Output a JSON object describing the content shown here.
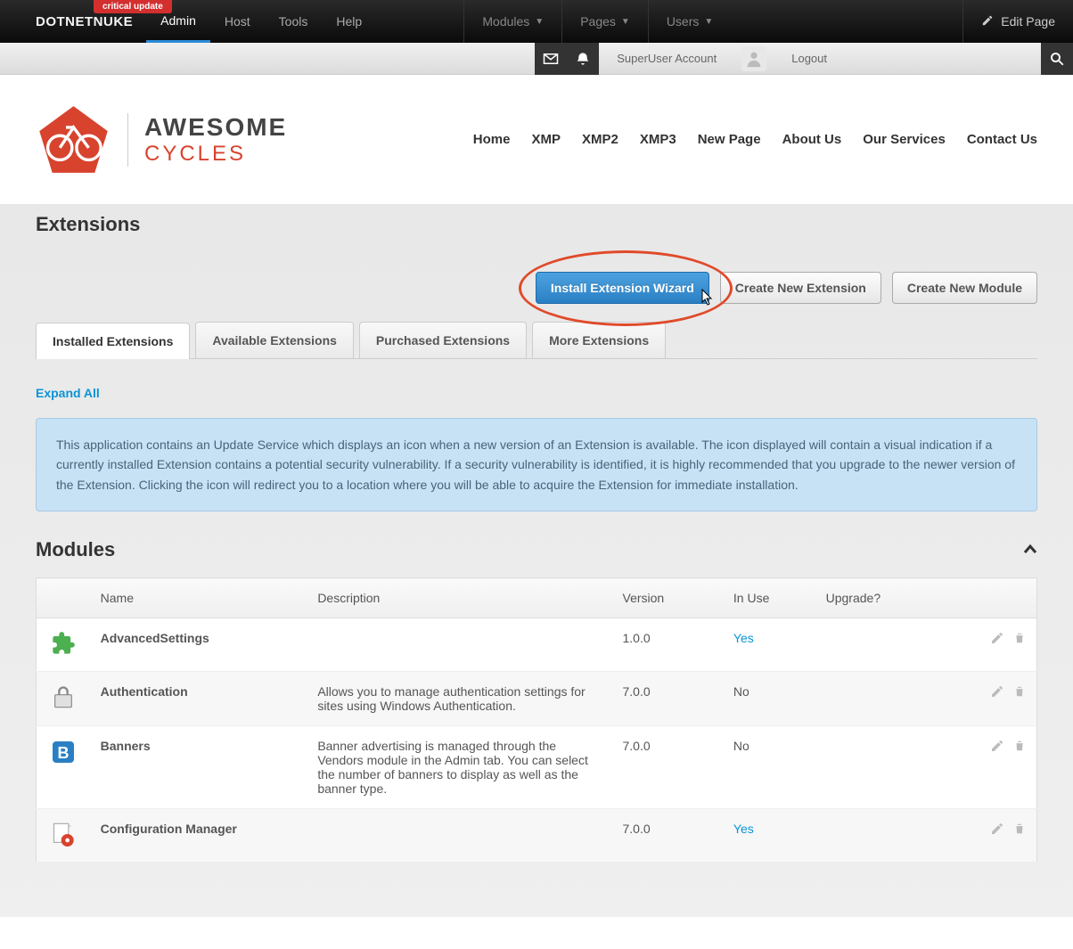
{
  "topbar": {
    "critical_badge": "critical update",
    "brand": "DotNetNuke",
    "menu": [
      "Admin",
      "Host",
      "Tools",
      "Help"
    ],
    "dropdowns": [
      "Modules",
      "Pages",
      "Users"
    ],
    "edit_page": "Edit Page"
  },
  "secbar": {
    "account": "SuperUser Account",
    "logout": "Logout"
  },
  "site": {
    "logo_line1": "AWESOME",
    "logo_line2": "CYCLES",
    "nav": [
      "Home",
      "XMP",
      "XMP2",
      "XMP3",
      "New Page",
      "About Us",
      "Our Services",
      "Contact Us"
    ]
  },
  "page": {
    "title": "Extensions",
    "actions": {
      "install": "Install Extension Wizard",
      "create_ext": "Create New Extension",
      "create_mod": "Create New Module"
    },
    "tabs": [
      "Installed Extensions",
      "Available Extensions",
      "Purchased Extensions",
      "More Extensions"
    ],
    "expand_all": "Expand All",
    "info": "This application contains an Update Service which displays an icon when a new version of an Extension is available. The icon displayed will contain a visual indication if a currently installed Extension contains a potential security vulnerability. If a security vulnerability is identified, it is highly recommended that you upgrade to the newer version of the Extension. Clicking the icon will redirect you to a location where you will be able to acquire the Extension for immediate installation.",
    "section_title": "Modules",
    "columns": {
      "name": "Name",
      "description": "Description",
      "version": "Version",
      "in_use": "In Use",
      "upgrade": "Upgrade?"
    },
    "rows": [
      {
        "icon": "puzzle",
        "name": "AdvancedSettings",
        "description": "",
        "version": "1.0.0",
        "in_use": "Yes"
      },
      {
        "icon": "lock",
        "name": "Authentication",
        "description": "Allows you to manage authentication settings for sites using Windows Authentication.",
        "version": "7.0.0",
        "in_use": "No"
      },
      {
        "icon": "banner",
        "name": "Banners",
        "description": "Banner advertising is managed through the Vendors module in the Admin tab. You can select the number of banners to display as well as the banner type.",
        "version": "7.0.0",
        "in_use": "No"
      },
      {
        "icon": "gear",
        "name": "Configuration Manager",
        "description": "",
        "version": "7.0.0",
        "in_use": "Yes"
      }
    ]
  }
}
